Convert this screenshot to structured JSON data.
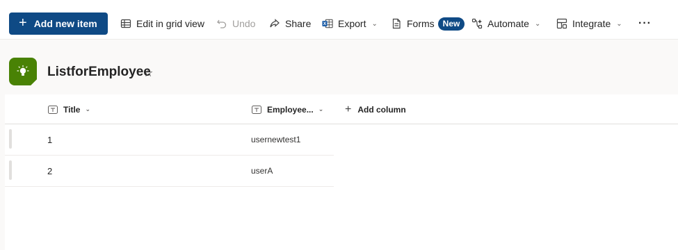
{
  "toolbar": {
    "add_new_item": "Add new item",
    "edit_grid": "Edit in grid view",
    "undo": "Undo",
    "share": "Share",
    "export": "Export",
    "forms": "Forms",
    "forms_badge": "New",
    "automate": "Automate",
    "integrate": "Integrate",
    "more": "···"
  },
  "list": {
    "title": "ListforEmployee",
    "favorite_icon": "☆",
    "logo_icon": "lightbulb-icon",
    "accent_color": "#498205"
  },
  "columns": {
    "title": "Title",
    "employee": "Employee...",
    "add_column": "Add column"
  },
  "rows": [
    {
      "title": "1",
      "employee": "usernewtest1"
    },
    {
      "title": "2",
      "employee": "userA"
    }
  ],
  "colors": {
    "primary": "#0f4a85",
    "logo": "#498205"
  }
}
